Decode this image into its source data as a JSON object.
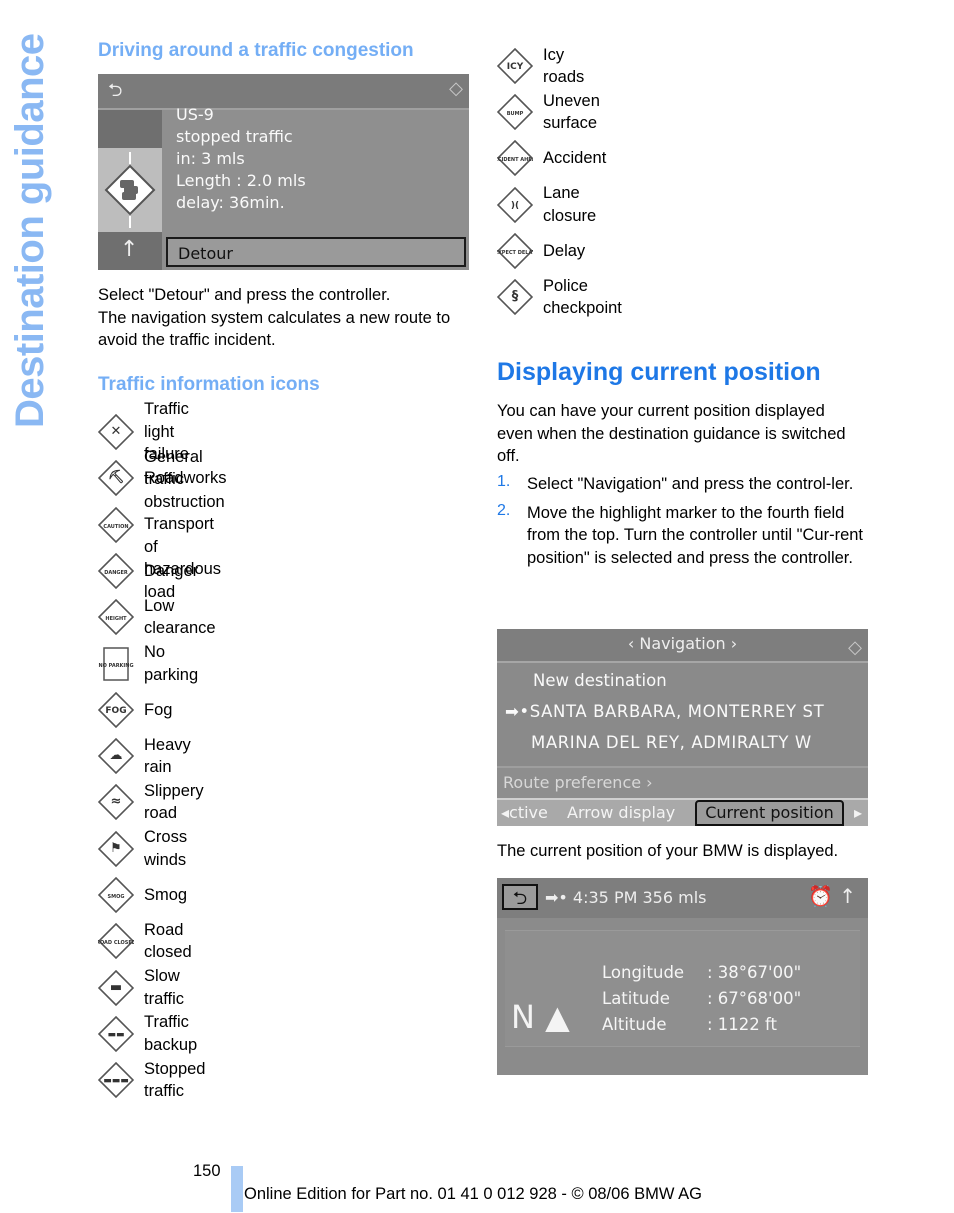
{
  "side_title": "Destination guidance",
  "left": {
    "heading1": "Driving around a traffic congestion",
    "screen1": {
      "back_icon": "back-arrow-icon",
      "controller_icon": "controller-icon",
      "lines": [
        "US-9",
        "stopped traffic",
        "in: 3 mls",
        "Length : 2.0 mls",
        "delay: 36min."
      ],
      "detour_label": "Detour",
      "up_arrow": "↑"
    },
    "para1_line1": "Select \"Detour\" and press the controller.",
    "para1_line2": "The navigation system calculates a new route to avoid the traffic incident.",
    "heading2": "Traffic information icons",
    "icons": [
      {
        "label": "Traffic light failure",
        "glyph": "✕"
      },
      {
        "label": "Roadworks",
        "glyph": "⛏"
      },
      {
        "label": "General traffic obstruction\nTransport of hazardous load",
        "glyph": "CAUTION"
      },
      {
        "label": "Danger",
        "glyph": "DANGER"
      },
      {
        "label": "Low clearance",
        "glyph": "HEIGHT"
      },
      {
        "label": "No parking",
        "glyph": "NO PARKING"
      },
      {
        "label": "Fog",
        "glyph": "FOG"
      },
      {
        "label": "Heavy rain",
        "glyph": "☁"
      },
      {
        "label": "Slippery road",
        "glyph": "≈"
      },
      {
        "label": "Cross winds",
        "glyph": "⚑"
      },
      {
        "label": "Smog",
        "glyph": "SMOG"
      },
      {
        "label": "Road closed",
        "glyph": "ROAD CLOSED"
      },
      {
        "label": "Slow traffic",
        "glyph": "▬"
      },
      {
        "label": "Traffic backup",
        "glyph": "▬▬"
      },
      {
        "label": "Stopped traffic",
        "glyph": "▬▬▬"
      }
    ]
  },
  "right": {
    "icons": [
      {
        "label": "Icy roads",
        "glyph": "ICY"
      },
      {
        "label": "Uneven surface",
        "glyph": "BUMP"
      },
      {
        "label": "Accident",
        "glyph": "ACCIDENT AHEAD"
      },
      {
        "label": "Lane closure",
        "glyph": ")("
      },
      {
        "label": "Delay",
        "glyph": "EXPECT DELAY"
      },
      {
        "label": "Police checkpoint",
        "glyph": "§"
      }
    ],
    "heading": "Displaying current position",
    "intro": "You can have your current position displayed even when the destination guidance is switched off.",
    "steps": [
      {
        "num": "1.",
        "text": "Select \"Navigation\" and press the control-ler."
      },
      {
        "num": "2.",
        "text": "Move the highlight marker to the fourth field from the top. Turn the controller until \"Cur-rent position\" is selected and press the controller."
      }
    ],
    "screen2": {
      "title": "‹  Navigation  ›",
      "rows": [
        "New destination",
        "➡•SANTA BARBARA, MONTERREY ST",
        "MARINA DEL REY, ADMIRALTY W"
      ],
      "route_pref": "Route preference ›",
      "tabs": [
        "◂ctive",
        "Arrow display",
        "Current position"
      ],
      "tab_right": "▸"
    },
    "after_text": "The current position of your BMW is displayed.",
    "screen3": {
      "back": "⮌",
      "status": "➡• 4:35 PM  356 mls",
      "icons": "⏰ ↑",
      "coords": [
        {
          "key": "Longitude",
          "value": ":  38°67'00\""
        },
        {
          "key": "Latitude",
          "value": ":  67°68'00\""
        },
        {
          "key": "Altitude",
          "value": ":  1122 ft"
        }
      ],
      "north": "N ▲"
    }
  },
  "footer": {
    "page_number": "150",
    "text": "Online Edition for Part no. 01 41 0 012 928 - © 08/06 BMW AG"
  },
  "colors": {
    "heading_light": "#74aef5",
    "heading_main": "#1e78e6",
    "side_title": "#8ab8f3",
    "footer_bar": "#a9cbf5"
  }
}
